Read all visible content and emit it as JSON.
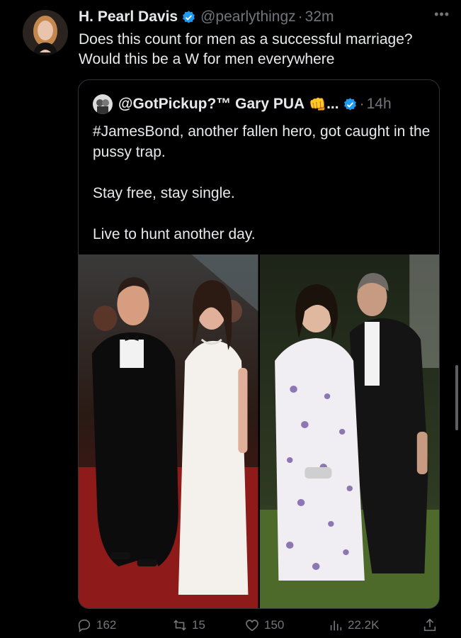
{
  "author": {
    "display_name": "H. Pearl Davis",
    "handle": "@pearlythingz",
    "time": "32m",
    "verified_icon": "verified-badge-icon"
  },
  "tweet": {
    "text": "Does this count for men as a successful marriage? Would this be a W for men everywhere"
  },
  "quote": {
    "display_name": "@GotPickup?™ Gary PUA",
    "emoji": "👊",
    "ellipsis": "...",
    "time": "14h",
    "paragraphs": [
      "#JamesBond, another fallen hero, got caught in the pussy trap.",
      "Stay free, stay single.",
      "Live to hunt another day."
    ]
  },
  "actions": {
    "replies": "162",
    "retweets": "15",
    "likes": "150",
    "views": "22.2K"
  },
  "colors": {
    "background": "#000000",
    "text": "#e7e9ea",
    "muted": "#71767b",
    "verified": "#1d9bf0",
    "border": "#2f3336"
  }
}
